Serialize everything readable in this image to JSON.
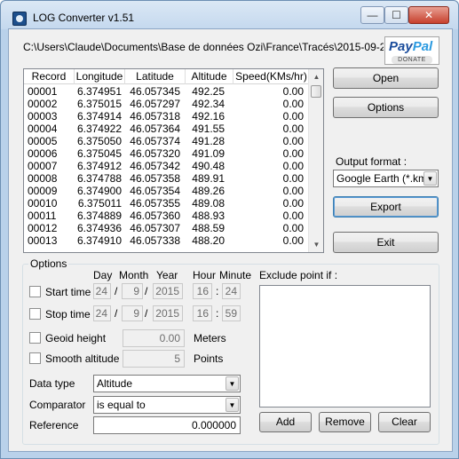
{
  "window": {
    "title": "LOG Converter v1.51",
    "min_glyph": "—",
    "max_glyph": "☐",
    "close_glyph": "✕"
  },
  "path": "C:\\Users\\Claude\\Documents\\Base de données Ozi\\France\\Tracés\\2015-09-24 Bella",
  "paypal": {
    "logo_a": "Pay",
    "logo_b": "Pal",
    "donate": "DONATE"
  },
  "table": {
    "columns": [
      "Record",
      "Longitude",
      "Latitude",
      "Altitude",
      "Speed(KMs/hr)"
    ],
    "rows": [
      [
        "00001",
        "6.374951",
        "46.057345",
        "492.25",
        "0.00"
      ],
      [
        "00002",
        "6.375015",
        "46.057297",
        "492.34",
        "0.00"
      ],
      [
        "00003",
        "6.374914",
        "46.057318",
        "492.16",
        "0.00"
      ],
      [
        "00004",
        "6.374922",
        "46.057364",
        "491.55",
        "0.00"
      ],
      [
        "00005",
        "6.375050",
        "46.057374",
        "491.28",
        "0.00"
      ],
      [
        "00006",
        "6.375045",
        "46.057320",
        "491.09",
        "0.00"
      ],
      [
        "00007",
        "6.374912",
        "46.057342",
        "490.48",
        "0.00"
      ],
      [
        "00008",
        "6.374788",
        "46.057358",
        "489.91",
        "0.00"
      ],
      [
        "00009",
        "6.374900",
        "46.057354",
        "489.26",
        "0.00"
      ],
      [
        "00010",
        "6.375011",
        "46.057355",
        "489.08",
        "0.00"
      ],
      [
        "00011",
        "6.374889",
        "46.057360",
        "488.93",
        "0.00"
      ],
      [
        "00012",
        "6.374936",
        "46.057307",
        "488.59",
        "0.00"
      ],
      [
        "00013",
        "6.374910",
        "46.057338",
        "488.20",
        "0.00"
      ]
    ]
  },
  "buttons": {
    "open": "Open",
    "options": "Options",
    "export": "Export",
    "exit": "Exit",
    "add": "Add",
    "remove": "Remove",
    "clear": "Clear"
  },
  "output": {
    "label": "Output format :",
    "value": "Google Earth (*.kml)"
  },
  "options": {
    "legend": "Options",
    "col_day": "Day",
    "col_month": "Month",
    "col_year": "Year",
    "col_hour": "Hour",
    "col_minute": "Minute",
    "start_label": "Start time",
    "stop_label": "Stop time",
    "start": {
      "day": "24",
      "month": "9",
      "year": "2015",
      "hour": "16",
      "minute": "24"
    },
    "stop": {
      "day": "24",
      "month": "9",
      "year": "2015",
      "hour": "16",
      "minute": "59"
    },
    "sep": "/",
    "colon": ":",
    "geoid_label": "Geoid height",
    "geoid_value": "0.00",
    "geoid_unit": "Meters",
    "smooth_label": "Smooth altitude",
    "smooth_value": "5",
    "smooth_unit": "Points",
    "exclude_label": "Exclude point if :",
    "datatype_label": "Data type",
    "datatype_value": "Altitude",
    "comparator_label": "Comparator",
    "comparator_value": "is equal to",
    "reference_label": "Reference",
    "reference_value": "0.000000"
  }
}
